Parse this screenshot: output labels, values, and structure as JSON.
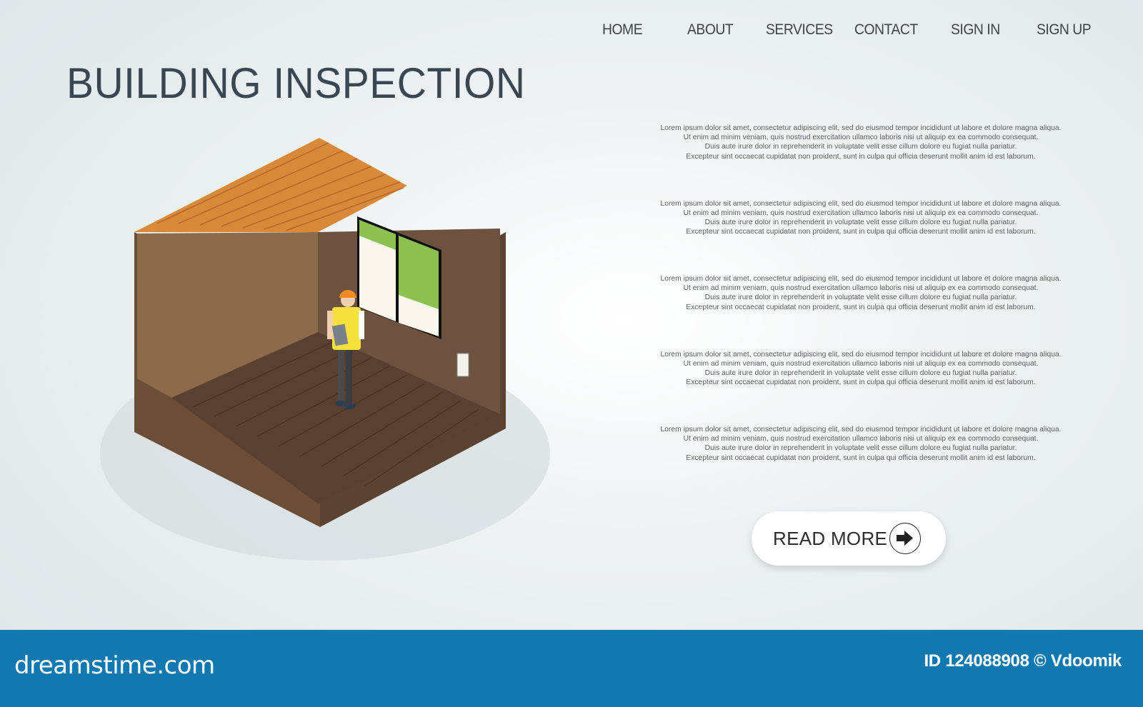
{
  "nav": {
    "items": [
      {
        "label": "HOME"
      },
      {
        "label": "ABOUT"
      },
      {
        "label": "SERVICES"
      },
      {
        "label": "CONTACT"
      },
      {
        "label": "SIGN IN"
      },
      {
        "label": "SIGN UP"
      }
    ]
  },
  "hero": {
    "title": "BUILDING INSPECTION",
    "illustration": "isometric-room-with-inspector-icon"
  },
  "paragraphs": [
    {
      "lines": [
        "Lorem ipsum dolor sit amet, consectetur adipiscing elit, sed do eiusmod tempor incididunt ut labore et dolore magna aliqua.",
        "Ut enim ad minim veniam, quis nostrud exercitation ullamco laboris nisi ut aliquip ex ea commodo consequat.",
        "Duis aute irure dolor in reprehenderit in voluptate velit esse cillum dolore eu fugiat nulla pariatur.",
        "Excepteur sint occaecat cupidatat non proident, sunt in culpa qui officia deserunt mollit anim id est laborum."
      ]
    },
    {
      "lines": [
        "Lorem ipsum dolor sit amet, consectetur adipiscing elit, sed do eiusmod tempor incididunt ut labore et dolore magna aliqua.",
        "Ut enim ad minim veniam, quis nostrud exercitation ullamco laboris nisi ut aliquip ex ea commodo consequat.",
        "Duis aute irure dolor in reprehenderit in voluptate velit esse cillum dolore eu fugiat nulla pariatur.",
        "Excepteur sint occaecat cupidatat non proident, sunt in culpa qui officia deserunt mollit anim id est laborum."
      ]
    },
    {
      "lines": [
        "Lorem ipsum dolor sit amet, consectetur adipiscing elit, sed do eiusmod tempor incididunt ut labore et dolore magna aliqua.",
        "Ut enim ad minim veniam, quis nostrud exercitation ullamco laboris nisi ut aliquip ex ea commodo consequat.",
        "Duis aute irure dolor in reprehenderit in voluptate velit esse cillum dolore eu fugiat nulla pariatur.",
        "Excepteur sint occaecat cupidatat non proident, sunt in culpa qui officia deserunt mollit anim id est laborum."
      ]
    },
    {
      "lines": [
        "Lorem ipsum dolor sit amet, consectetur adipiscing elit, sed do eiusmod tempor incididunt ut labore et dolore magna aliqua.",
        "Ut enim ad minim veniam, quis nostrud exercitation ullamco laboris nisi ut aliquip ex ea commodo consequat.",
        "Duis aute irure dolor in reprehenderit in voluptate velit esse cillum dolore eu fugiat nulla pariatur.",
        "Excepteur sint occaecat cupidatat non proident, sunt in culpa qui officia deserunt mollit anim id est laborum."
      ]
    },
    {
      "lines": [
        "Lorem ipsum dolor sit amet, consectetur adipiscing elit, sed do eiusmod tempor incididunt ut labore et dolore magna aliqua.",
        "Ut enim ad minim veniam, quis nostrud exercitation ullamco laboris nisi ut aliquip ex ea commodo consequat.",
        "Duis aute irure dolor in reprehenderit in voluptate velit esse cillum dolore eu fugiat nulla pariatur.",
        "Excepteur sint occaecat cupidatat non proident, sunt in culpa qui officia deserunt mollit anim id est laborum."
      ]
    }
  ],
  "cta": {
    "label": "READ MORE",
    "icon": "arrow-right-icon"
  },
  "footer": {
    "brand": "dreamstime.com",
    "credit": "ID 124088908 © Vdoomik",
    "color": "#1178b0"
  },
  "colors": {
    "title": "#3a4652",
    "roof": "#d9893a",
    "wall_left": "#8c6a4c",
    "wall_right": "#6e5240",
    "floor": "#5a4030",
    "window_green": "#8cc152",
    "vest": "#f5e13c",
    "helmet": "#f08a24"
  }
}
